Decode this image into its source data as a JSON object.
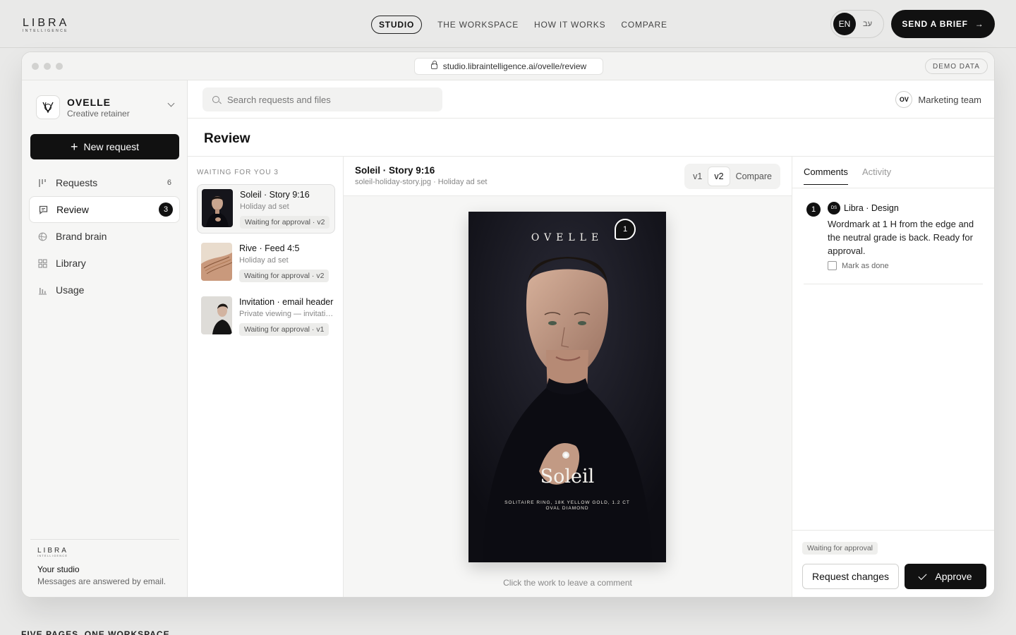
{
  "site": {
    "logo_word": "LIBRA",
    "logo_sub": "INTELLIGENCE",
    "links": [
      "STUDIO",
      "THE WORKSPACE",
      "HOW IT WORKS",
      "COMPARE"
    ],
    "lang_en": "EN",
    "lang_he": "עב",
    "brief_label": "SEND A BRIEF"
  },
  "browser": {
    "url": "studio.libraintelligence.ai/ovelle/review",
    "demo_badge": "DEMO DATA"
  },
  "sidebar": {
    "org_name": "OVELLE",
    "org_sub": "Creative retainer",
    "new_request": "New request",
    "items": [
      {
        "label": "Requests",
        "count": "6",
        "icon": "requests-icon"
      },
      {
        "label": "Review",
        "count": "3",
        "icon": "review-icon"
      },
      {
        "label": "Brand brain",
        "count": "",
        "icon": "globe-icon"
      },
      {
        "label": "Library",
        "count": "",
        "icon": "grid-icon"
      },
      {
        "label": "Usage",
        "count": "",
        "icon": "bar-chart-icon"
      }
    ],
    "footer": {
      "logo_word": "LIBRA",
      "logo_sub": "INTELLIGENCE",
      "title": "Your studio",
      "message": "Messages are answered by email."
    }
  },
  "header": {
    "search_placeholder": "Search requests and files",
    "team_avatar": "OV",
    "team_label": "Marketing team",
    "page_title": "Review"
  },
  "queue": {
    "heading": "WAITING FOR YOU 3",
    "items": [
      {
        "title": "Soleil · Story 9:16",
        "sub": "Holiday ad set",
        "badge": "Waiting for approval · v2"
      },
      {
        "title": "Rive · Feed 4:5",
        "sub": "Holiday ad set",
        "badge": "Waiting for approval · v2"
      },
      {
        "title": "Invitation · email header",
        "sub": "Private viewing — invitation",
        "badge": "Waiting for approval · v1"
      }
    ]
  },
  "viewer": {
    "title": "Soleil · Story 9:16",
    "sub": "soleil-holiday-story.jpg · Holiday ad set",
    "versions": [
      "v1",
      "v2",
      "Compare"
    ],
    "art_brand": "OVELLE",
    "art_name": "Soleil",
    "art_caption_1": "SOLITAIRE RING, 18K YELLOW GOLD, 1.2 CT",
    "art_caption_2": "OVAL DIAMOND",
    "pin_number": "1",
    "hint": "Click the work to leave a comment"
  },
  "comments": {
    "tabs": [
      "Comments",
      "Activity"
    ],
    "items": [
      {
        "number": "1",
        "avatar": "DS",
        "author": "Libra · Design",
        "body": "Wordmark at 1 H from the edge and the neutral grade is back. Ready for approval.",
        "done_label": "Mark as done"
      }
    ],
    "status": "Waiting for approval",
    "request_changes": "Request changes",
    "approve": "Approve"
  },
  "below_text": "FIVE PAGES, ONE WORKSPACE",
  "colors": {
    "accent": "#111111",
    "page_bg": "#e9e9e8",
    "art_bg": "#111118"
  }
}
